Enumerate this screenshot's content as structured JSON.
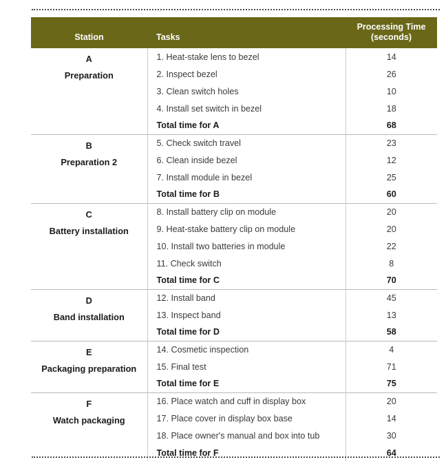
{
  "table": {
    "headers": {
      "station": "Station",
      "tasks": "Tasks",
      "time_line1": "Processing Time",
      "time_line2": "(seconds)"
    },
    "accent_color": "#6b6719",
    "header_text_color": "#ffffff",
    "body_text_color": "#3a3a3c",
    "rule_color": "#c9c9c9",
    "stations": [
      {
        "letter": "A",
        "name": "Preparation",
        "tasks": [
          {
            "label": "1. Heat-stake lens to bezel",
            "time": "14"
          },
          {
            "label": "2. Inspect bezel",
            "time": "26"
          },
          {
            "label": "3. Clean switch holes",
            "time": "10"
          },
          {
            "label": "4. Install set switch in bezel",
            "time": "18"
          }
        ],
        "total_label": "Total time for A",
        "total_time": "68"
      },
      {
        "letter": "B",
        "name": "Preparation 2",
        "tasks": [
          {
            "label": "5. Check switch travel",
            "time": "23"
          },
          {
            "label": "6. Clean inside bezel",
            "time": "12"
          },
          {
            "label": "7. Install module in bezel",
            "time": "25"
          }
        ],
        "total_label": "Total time for B",
        "total_time": "60"
      },
      {
        "letter": "C",
        "name": "Battery installation",
        "tasks": [
          {
            "label": "8. Install battery clip on module",
            "time": "20"
          },
          {
            "label": "9. Heat-stake battery clip on module",
            "time": "20"
          },
          {
            "label": "10. Install two batteries in module",
            "time": "22"
          },
          {
            "label": "11. Check switch",
            "time": "8"
          }
        ],
        "total_label": "Total time for C",
        "total_time": "70"
      },
      {
        "letter": "D",
        "name": "Band installation",
        "tasks": [
          {
            "label": "12. Install band",
            "time": "45"
          },
          {
            "label": "13. Inspect band",
            "time": "13"
          }
        ],
        "total_label": "Total time for D",
        "total_time": "58"
      },
      {
        "letter": "E",
        "name": "Packaging preparation",
        "tasks": [
          {
            "label": "14. Cosmetic inspection",
            "time": "4"
          },
          {
            "label": "15. Final test",
            "time": "71"
          }
        ],
        "total_label": "Total time for E",
        "total_time": "75"
      },
      {
        "letter": "F",
        "name": "Watch packaging",
        "tasks": [
          {
            "label": "16. Place watch and cuff in display box",
            "time": "20"
          },
          {
            "label": "17. Place cover in display box base",
            "time": "14"
          },
          {
            "label": "18. Place owner's manual and box into tub",
            "time": "30"
          }
        ],
        "total_label": "Total time for F",
        "total_time": "64"
      }
    ]
  }
}
